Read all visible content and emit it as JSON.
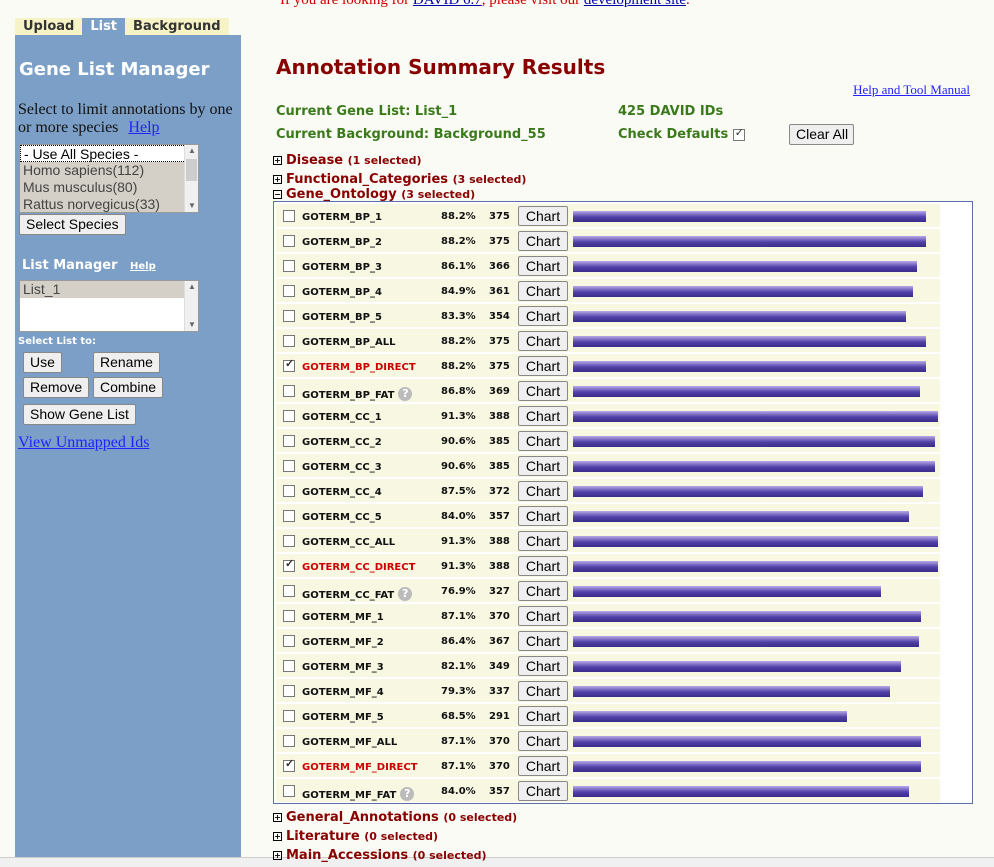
{
  "tabs": [
    "Upload",
    "List",
    "Background"
  ],
  "sidebar": {
    "title": "Gene List Manager",
    "instructions": "Select to limit annotations by one or more species",
    "help": "Help",
    "species": [
      "- Use All Species -",
      "Homo sapiens(112)",
      "Mus musculus(80)",
      "Rattus norvegicus(33)"
    ],
    "select_species": "Select Species",
    "list_manager": "List Manager",
    "list_help": "Help",
    "lists": [
      "List_1"
    ],
    "select_list_to": "Select List to:",
    "use": "Use",
    "rename": "Rename",
    "remove": "Remove",
    "combine": "Combine",
    "show_gene_list": "Show Gene List",
    "unmapped": "View Unmapped Ids"
  },
  "banner": {
    "pre": "If you are looking for ",
    "link1": "DAVID 6.7",
    "mid": ", please visit our ",
    "link2": "development site",
    "post": "."
  },
  "title": "Annotation Summary Results",
  "manual": "Help and Tool Manual",
  "current_list": "Current Gene List: List_1",
  "current_background": "Current Background: Background_55",
  "david_ids": "425 DAVID IDs",
  "check_defaults": "Check Defaults",
  "clear_all": "Clear All",
  "categories_top": [
    {
      "name": "Disease",
      "sel": "(1 selected)",
      "sign": "+"
    },
    {
      "name": "Functional_Categories",
      "sel": "(3 selected)",
      "sign": "+"
    },
    {
      "name": "Gene_Ontology",
      "sel": "(3 selected)",
      "sign": "−"
    }
  ],
  "categories_bottom": [
    {
      "name": "General_Annotations",
      "sel": "(0 selected)",
      "sign": "+"
    },
    {
      "name": "Literature",
      "sel": "(0 selected)",
      "sign": "+"
    },
    {
      "name": "Main_Accessions",
      "sel": "(0 selected)",
      "sign": "+"
    }
  ],
  "chart_label": "Chart",
  "go_terms": [
    {
      "name": "GOTERM_BP_1",
      "pct": "88.2%",
      "count": 375,
      "checked": false,
      "help": false
    },
    {
      "name": "GOTERM_BP_2",
      "pct": "88.2%",
      "count": 375,
      "checked": false,
      "help": false
    },
    {
      "name": "GOTERM_BP_3",
      "pct": "86.1%",
      "count": 366,
      "checked": false,
      "help": false
    },
    {
      "name": "GOTERM_BP_4",
      "pct": "84.9%",
      "count": 361,
      "checked": false,
      "help": false
    },
    {
      "name": "GOTERM_BP_5",
      "pct": "83.3%",
      "count": 354,
      "checked": false,
      "help": false
    },
    {
      "name": "GOTERM_BP_ALL",
      "pct": "88.2%",
      "count": 375,
      "checked": false,
      "help": false
    },
    {
      "name": "GOTERM_BP_DIRECT",
      "pct": "88.2%",
      "count": 375,
      "checked": true,
      "help": false
    },
    {
      "name": "GOTERM_BP_FAT",
      "pct": "86.8%",
      "count": 369,
      "checked": false,
      "help": true
    },
    {
      "name": "GOTERM_CC_1",
      "pct": "91.3%",
      "count": 388,
      "checked": false,
      "help": false
    },
    {
      "name": "GOTERM_CC_2",
      "pct": "90.6%",
      "count": 385,
      "checked": false,
      "help": false
    },
    {
      "name": "GOTERM_CC_3",
      "pct": "90.6%",
      "count": 385,
      "checked": false,
      "help": false
    },
    {
      "name": "GOTERM_CC_4",
      "pct": "87.5%",
      "count": 372,
      "checked": false,
      "help": false
    },
    {
      "name": "GOTERM_CC_5",
      "pct": "84.0%",
      "count": 357,
      "checked": false,
      "help": false
    },
    {
      "name": "GOTERM_CC_ALL",
      "pct": "91.3%",
      "count": 388,
      "checked": false,
      "help": false
    },
    {
      "name": "GOTERM_CC_DIRECT",
      "pct": "91.3%",
      "count": 388,
      "checked": true,
      "help": false
    },
    {
      "name": "GOTERM_CC_FAT",
      "pct": "76.9%",
      "count": 327,
      "checked": false,
      "help": true
    },
    {
      "name": "GOTERM_MF_1",
      "pct": "87.1%",
      "count": 370,
      "checked": false,
      "help": false
    },
    {
      "name": "GOTERM_MF_2",
      "pct": "86.4%",
      "count": 367,
      "checked": false,
      "help": false
    },
    {
      "name": "GOTERM_MF_3",
      "pct": "82.1%",
      "count": 349,
      "checked": false,
      "help": false
    },
    {
      "name": "GOTERM_MF_4",
      "pct": "79.3%",
      "count": 337,
      "checked": false,
      "help": false
    },
    {
      "name": "GOTERM_MF_5",
      "pct": "68.5%",
      "count": 291,
      "checked": false,
      "help": false
    },
    {
      "name": "GOTERM_MF_ALL",
      "pct": "87.1%",
      "count": 370,
      "checked": false,
      "help": false
    },
    {
      "name": "GOTERM_MF_DIRECT",
      "pct": "87.1%",
      "count": 370,
      "checked": true,
      "help": false
    },
    {
      "name": "GOTERM_MF_FAT",
      "pct": "84.0%",
      "count": 357,
      "checked": false,
      "help": true
    }
  ]
}
